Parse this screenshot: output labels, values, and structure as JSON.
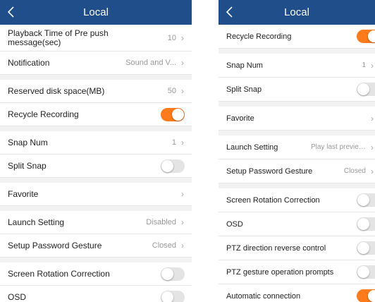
{
  "left": {
    "title": "Local",
    "rows": [
      {
        "label": "Playback Time of Pre push message(sec)",
        "value": "10"
      },
      {
        "label": "Notification",
        "value": "Sound and V..."
      },
      {
        "label": "Reserved disk space(MB)",
        "value": "50"
      },
      {
        "label": "Recycle Recording",
        "toggle": true
      },
      {
        "label": "Snap Num",
        "value": "1"
      },
      {
        "label": "Split Snap",
        "toggle": false
      },
      {
        "label": "Favorite"
      },
      {
        "label": "Launch Setting",
        "value": "Disabled"
      },
      {
        "label": "Setup Password Gesture",
        "value": "Closed"
      },
      {
        "label": "Screen Rotation Correction",
        "toggle": false
      },
      {
        "label": "OSD",
        "toggle": false
      }
    ]
  },
  "right": {
    "title": "Local",
    "rows": [
      {
        "label": "Recycle Recording",
        "toggle": true
      },
      {
        "label": "Snap Num",
        "value": "1"
      },
      {
        "label": "Split Snap",
        "toggle": false
      },
      {
        "label": "Favorite"
      },
      {
        "label": "Launch Setting",
        "value": "Play last preview c···"
      },
      {
        "label": "Setup Password Gesture",
        "value": "Closed"
      },
      {
        "label": "Screen Rotation Correction",
        "toggle": false
      },
      {
        "label": "OSD",
        "toggle": false
      },
      {
        "label": "PTZ direction reverse control",
        "toggle": false
      },
      {
        "label": "PTZ gesture operation prompts",
        "toggle": false
      },
      {
        "label": "Automatic connection",
        "toggle": true
      }
    ]
  },
  "icons": {
    "back": "chevron-left-icon",
    "row_arrow": "chevron-right-icon"
  },
  "colors": {
    "header": "#1f4e8a",
    "toggle_on": "#ff7a1a",
    "toggle_off": "#e4e4e4",
    "chevron": "#a6a6a6"
  }
}
